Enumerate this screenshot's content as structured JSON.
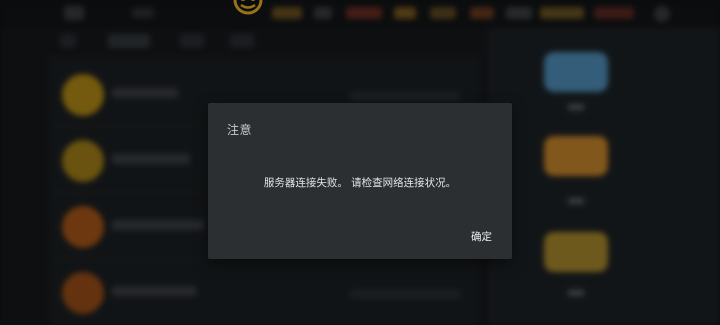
{
  "dialog": {
    "title": "注意",
    "message": "服务器连接失败。 请检查网络连接状况。",
    "confirm_label": "确定"
  },
  "colors": {
    "dialog_bg": "#2b2f32",
    "overlay": "#000000",
    "accent_gold": "#e8b325",
    "badge_gold": "#b38a17",
    "badge_orange": "#a8571a",
    "chest_blue": "#4f8fb8",
    "chest_orange": "#c8862c"
  },
  "icons": {
    "top_emblem": "gold-coin-icon",
    "settings": "gear-icon"
  }
}
